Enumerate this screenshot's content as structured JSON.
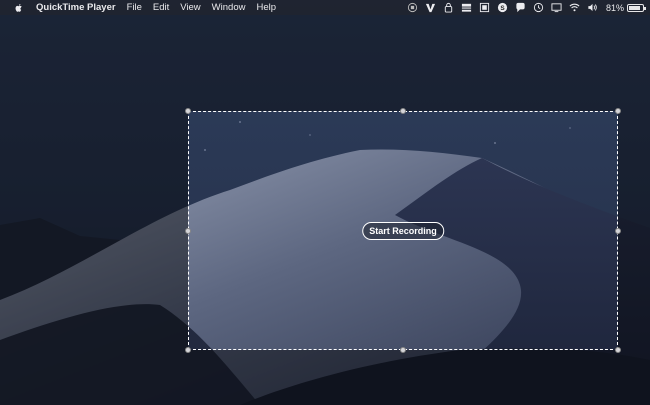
{
  "menubar": {
    "app_name": "QuickTime Player",
    "menus": [
      "File",
      "Edit",
      "View",
      "Window",
      "Help"
    ],
    "battery_percent": "81%",
    "battery_level": 0.81
  },
  "status_icons": [
    "record-stop-icon",
    "vectorize-icon",
    "lock-icon",
    "theater-icon",
    "filesafe-icon",
    "skype-icon",
    "chat-icon",
    "time-machine-icon",
    "display-icon",
    "wifi-icon",
    "volume-icon",
    "battery-icon"
  ],
  "capture": {
    "button_label": "Start Recording"
  },
  "colors": {
    "accent": "#ffffff",
    "menubar_bg": "#1c1e26",
    "sky": "#2c3a55"
  }
}
